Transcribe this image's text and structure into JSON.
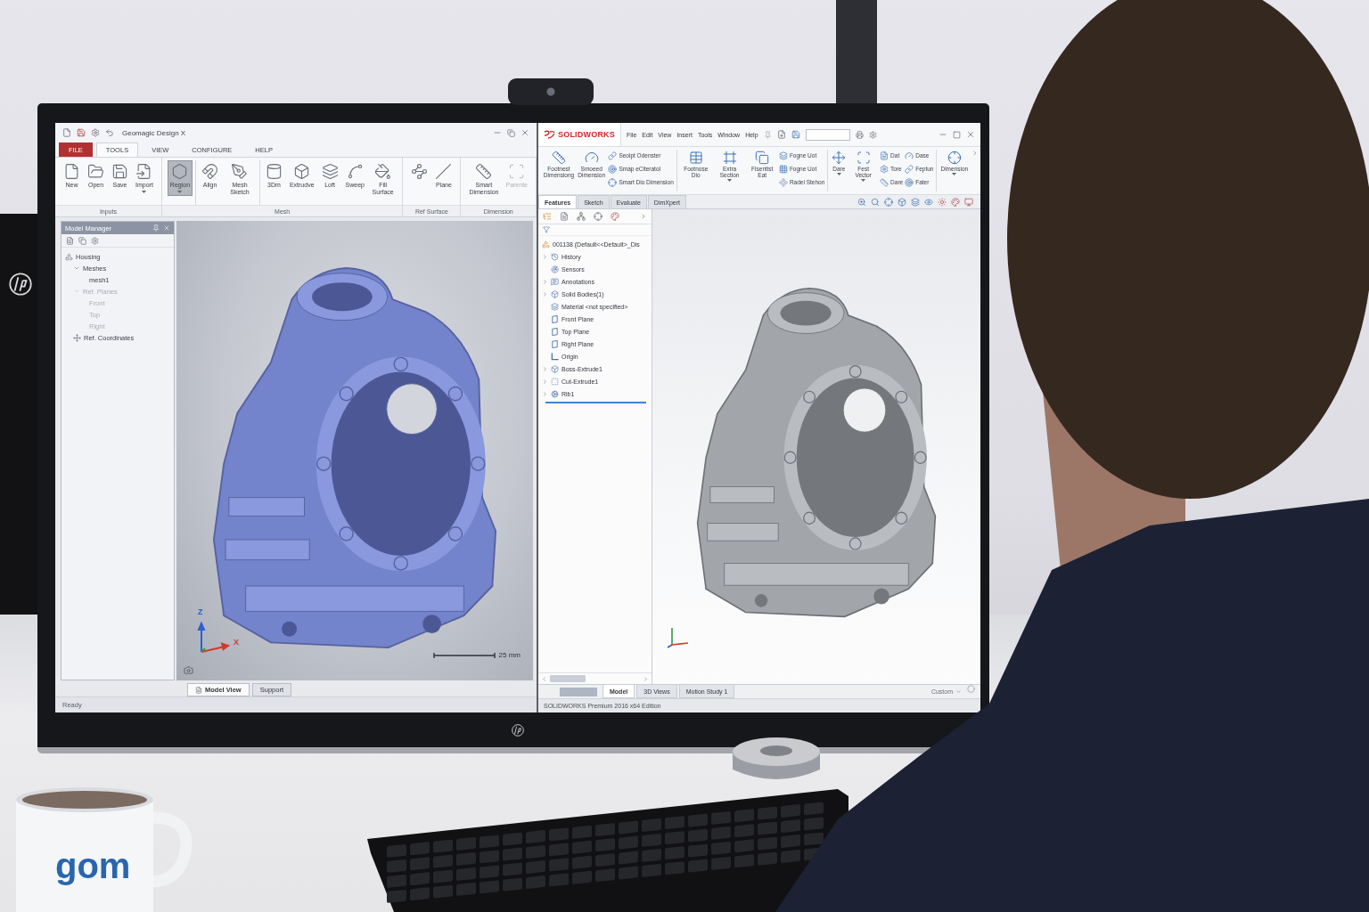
{
  "geomagic": {
    "title": "Geomagic Design X",
    "tabs": [
      {
        "label": "FILE",
        "kind": "file",
        "selected": false
      },
      {
        "label": "TOOLS",
        "kind": "tab",
        "selected": true
      },
      {
        "label": "VIEW",
        "kind": "tab",
        "selected": false
      },
      {
        "label": "CONFIGURE",
        "kind": "tab",
        "selected": false
      },
      {
        "label": "HELP",
        "kind": "tab",
        "selected": false
      }
    ],
    "ribbon_groups": [
      {
        "label": "Inputs",
        "sections": [
          [
            {
              "label": "New",
              "dropdown": false
            },
            {
              "label": "Open",
              "dropdown": false
            },
            {
              "label": "Save",
              "dropdown": false
            },
            {
              "label": "Import",
              "dropdown": true
            }
          ]
        ]
      },
      {
        "label": "Mesh",
        "sections": [
          [
            {
              "label": "Region",
              "dropdown": true,
              "pressed": true
            }
          ],
          [
            {
              "label": "Align"
            },
            {
              "label": "Mesh Sketch"
            }
          ],
          [
            {
              "label": "3Dm"
            },
            {
              "label": "Extrudve"
            },
            {
              "label": "Loft"
            },
            {
              "label": "Sweep"
            },
            {
              "label": "Fill Surface"
            }
          ]
        ]
      },
      {
        "label": "Ref Surface",
        "sections": [
          [
            {
              "kind": "icon"
            },
            {
              "kind": "labeled",
              "label": "Plane"
            }
          ]
        ]
      },
      {
        "label": "Dimension",
        "sections": [
          [
            {
              "label": "Smart Dimension",
              "disabled": false
            },
            {
              "label": "Parente",
              "disabled": true
            }
          ]
        ]
      }
    ],
    "model_manager": {
      "title": "Model Manager",
      "tree": [
        {
          "label": "Housing",
          "dimmed": false,
          "children": [
            {
              "label": "Meshes",
              "dimmed": false,
              "children": [
                {
                  "label": "mesh1",
                  "dimmed": false
                }
              ]
            },
            {
              "label": "Ref. Planes",
              "dimmed": true,
              "children": [
                {
                  "label": "Front",
                  "dimmed": true
                },
                {
                  "label": "Top",
                  "dimmed": true
                },
                {
                  "label": "Right",
                  "dimmed": true
                }
              ]
            },
            {
              "label": "Ref. Coordinates",
              "dimmed": false
            }
          ]
        }
      ]
    },
    "viewport": {
      "axis_labels": [
        "Z",
        "X"
      ],
      "scale_bar": "25 mm"
    },
    "view_tabs": [
      {
        "label": "Model View",
        "selected": true
      },
      {
        "label": "Support",
        "selected": false
      }
    ],
    "status": "Ready"
  },
  "solidworks": {
    "brand": "SOLIDWORKS",
    "menu": [
      "File",
      "Edit",
      "View",
      "Insert",
      "Tools",
      "Window",
      "Help"
    ],
    "ribbon_sections": [
      [
        {
          "kind": "large",
          "label": "Footnest Dimensiong",
          "dropdown": false
        },
        {
          "kind": "large",
          "label": "Smoeed Dimension",
          "dropdown": false
        },
        {
          "kind": "stack",
          "labels": [
            "Seolpt Odenster",
            "Smap eCiteratol",
            "Smart Dio Dimension"
          ]
        }
      ],
      [
        {
          "kind": "large",
          "label": "Footnose Dio",
          "dropdown": false
        },
        {
          "kind": "large",
          "label": "Extra Section",
          "dropdown": true
        },
        {
          "kind": "large",
          "label": "Fisentist Eat",
          "dropdown": false
        },
        {
          "kind": "stack",
          "labels": [
            "Fogne Uot",
            "Fogne Uot",
            "Radel Stehon"
          ]
        }
      ],
      [
        {
          "kind": "large",
          "label": "Dare",
          "dropdown": true
        },
        {
          "kind": "large",
          "label": "Fest Vector",
          "dropdown": true
        },
        {
          "kind": "stack",
          "labels": [
            "Dat",
            "Tore",
            "Dare"
          ]
        },
        {
          "kind": "stack",
          "labels": [
            "Dase",
            "Feptun",
            "Fater"
          ]
        }
      ],
      [
        {
          "kind": "large",
          "label": "Dimension",
          "dropdown": true
        }
      ]
    ],
    "tabs": [
      {
        "label": "Features",
        "selected": true
      },
      {
        "label": "Sketch",
        "selected": false
      },
      {
        "label": "Evaluate",
        "selected": false
      },
      {
        "label": "DimXpert",
        "selected": false
      }
    ],
    "tree": {
      "root": "001138 (Default<<Default>_Dis",
      "items": [
        {
          "label": "History",
          "caret": true
        },
        {
          "label": "Sensors",
          "caret": false
        },
        {
          "label": "Annotations",
          "caret": true
        },
        {
          "label": "Solid Bodies(1)",
          "caret": true
        },
        {
          "label": "Material <not specified>",
          "caret": false
        },
        {
          "label": "Front Plane",
          "caret": false
        },
        {
          "label": "Top Plane",
          "caret": false
        },
        {
          "label": "Right Plane",
          "caret": false
        },
        {
          "label": "Origin",
          "caret": false
        },
        {
          "label": "Boss-Extrude1",
          "caret": true
        },
        {
          "label": "Cut-Extrude1",
          "caret": true
        },
        {
          "label": "Rib1",
          "caret": true
        }
      ]
    },
    "bottom_tabs": [
      {
        "label": "Model",
        "selected": true
      },
      {
        "label": "3D Views",
        "selected": false
      },
      {
        "label": "Motion Study 1",
        "selected": false
      }
    ],
    "units": "Custom",
    "status": "SOLIDWORKS Premium 2016 x64 Edition"
  },
  "desk": {
    "mug_logo": "gom"
  }
}
